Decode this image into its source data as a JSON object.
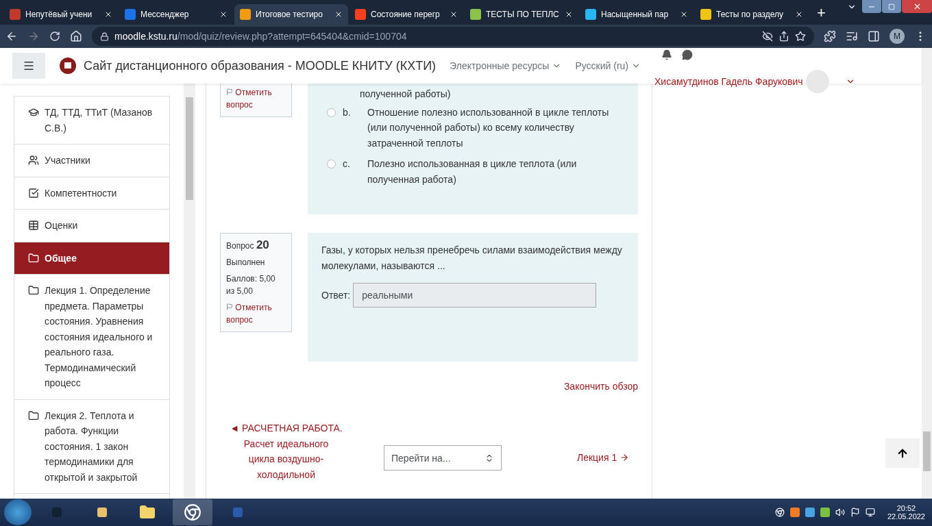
{
  "browser": {
    "tabs": [
      {
        "title": "Непутёвый учени",
        "selected": false,
        "color": "#c0392b"
      },
      {
        "title": "Мессенджер",
        "selected": false,
        "color": "#1a73e8"
      },
      {
        "title": "Итоговое тестиро",
        "selected": true,
        "color": "#f39c12"
      },
      {
        "title": "Состояние перегр",
        "selected": false,
        "color": "#fc3f1d"
      },
      {
        "title": "ТЕСТЫ ПО ТЕПЛС",
        "selected": false,
        "color": "#8bc34a"
      },
      {
        "title": "Насыщенный пар",
        "selected": false,
        "color": "#29b6f6"
      },
      {
        "title": "Тесты по разделу",
        "selected": false,
        "color": "#f1c40f"
      }
    ],
    "new_tab": "+",
    "url_host": "moodle.kstu.ru",
    "url_path": "/mod/quiz/review.php?attempt=645404&cmid=100704",
    "profile": "M"
  },
  "navbar": {
    "site_name": "Сайт дистанционного образования - MOODLE КНИТУ (КХТИ)",
    "menus": [
      "Электронные ресурсы",
      "Русский (ru)"
    ],
    "user_name": "Хисамутдинов Гадель Фарукович"
  },
  "sidebar": {
    "items": [
      {
        "label": "ТД, ТТД, ТТиТ (Мазанов С.В.)",
        "kind": "course",
        "selected": false
      },
      {
        "label": "Участники",
        "kind": "participants",
        "selected": false
      },
      {
        "label": "Компетентности",
        "kind": "competencies",
        "selected": false
      },
      {
        "label": "Оценки",
        "kind": "grades",
        "selected": false
      },
      {
        "label": "Общее",
        "kind": "folder",
        "selected": true
      },
      {
        "label": "Лекция 1. Определение предмета. Параметры состояния. Уравнения состояния идеального и реального газа. Термодинамический процесс",
        "kind": "folder",
        "selected": false
      },
      {
        "label": "Лекция 2. Теплота и работа. Функции состояния. 1 закон термодинамики для открытой и закрытой",
        "kind": "folder",
        "selected": false
      }
    ]
  },
  "question_19": {
    "flag": "Отметить вопрос",
    "option_a_tail": "полученной работы)",
    "options": [
      {
        "letter": "b.",
        "text": "Отношение полезно использованной в цикле теплоты (или полученной работы) ко всему количеству затраченной теплоты",
        "selected": false
      },
      {
        "letter": "c.",
        "text": "Полезно использованная в цикле теплота (или полученная работа)",
        "selected": false
      }
    ]
  },
  "question_20": {
    "label": "Вопрос",
    "number": "20",
    "state": "Выполнен",
    "grade": "Баллов: 5,00 из 5,00",
    "flag": "Отметить вопрос",
    "text": "Газы, у которых нельзя пренебречь силами взаимодействия между молекулами, называются ...",
    "answer_label": "Ответ:",
    "answer": "реальными"
  },
  "finish_link": "Закончить обзор",
  "activity_nav": {
    "previous_arrow": "◄",
    "previous": "РАСЧЕТНАЯ РАБОТА. Расчет идеального цикла воздушно-холодильной",
    "jump": "Перейти на...",
    "next": "Лекция 1"
  },
  "taskbar": {
    "time": "20:52",
    "date": "22.05.2022"
  }
}
